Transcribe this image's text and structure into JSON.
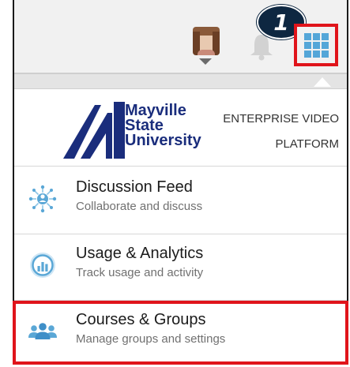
{
  "topbar": {
    "badge": "1",
    "avatar_icon": "user-avatar",
    "bell_icon": "bell-icon",
    "apps_icon": "apps-grid-icon",
    "accent_color": "#54a6d8",
    "highlight_color": "#e0141b"
  },
  "brand": {
    "university_lines": [
      "Mayville",
      "State",
      "University"
    ],
    "platform_lines": [
      "ENTERPRISE VIDEO",
      "PLATFORM"
    ]
  },
  "menu": {
    "items": [
      {
        "title": "Discussion Feed",
        "subtitle": "Collaborate and discuss",
        "icon": "discussion-network-icon"
      },
      {
        "title": "Usage & Analytics",
        "subtitle": "Track usage and activity",
        "icon": "analytics-chart-icon"
      },
      {
        "title": "Courses & Groups",
        "subtitle": "Manage groups and settings",
        "icon": "group-people-icon"
      }
    ]
  }
}
